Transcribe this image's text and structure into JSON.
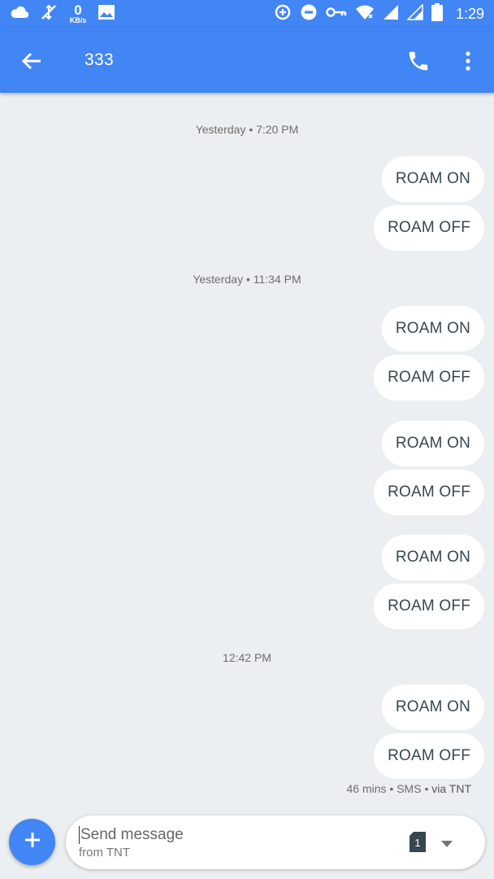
{
  "status_bar": {
    "data_rate_value": "0",
    "data_rate_unit": "KB/s",
    "time": "1:29",
    "icons": [
      "cloud-icon",
      "no-sync-icon",
      "image-icon",
      "data-saver-icon",
      "do-not-disturb-icon",
      "vpn-key-icon",
      "wifi-icon",
      "signal-icon",
      "signal-icon",
      "battery-icon"
    ]
  },
  "toolbar": {
    "title": "333",
    "back_icon": "arrow-back-icon",
    "call_icon": "phone-icon",
    "more_icon": "more-vert-icon",
    "color": "#4285f4"
  },
  "conversation": {
    "timestamps": [
      "Yesterday • 7:20 PM",
      "Yesterday • 11:34 PM",
      "12:42 PM"
    ],
    "messages": [
      {
        "text": "ROAM ON"
      },
      {
        "text": "ROAM OFF"
      },
      {
        "text": "ROAM ON"
      },
      {
        "text": "ROAM OFF"
      },
      {
        "text": "ROAM ON"
      },
      {
        "text": "ROAM OFF"
      },
      {
        "text": "ROAM ON"
      },
      {
        "text": "ROAM OFF"
      },
      {
        "text": "ROAM ON"
      },
      {
        "text": "ROAM OFF"
      }
    ],
    "last_message_meta": {
      "age": "46 mins",
      "separator": " • ",
      "type": "SMS",
      "via": "via TNT"
    }
  },
  "compose": {
    "placeholder": "Send message",
    "subtitle": "from TNT",
    "sim_slot": "1",
    "add_icon": "plus-icon",
    "dropdown_icon": "caret-down-icon"
  }
}
